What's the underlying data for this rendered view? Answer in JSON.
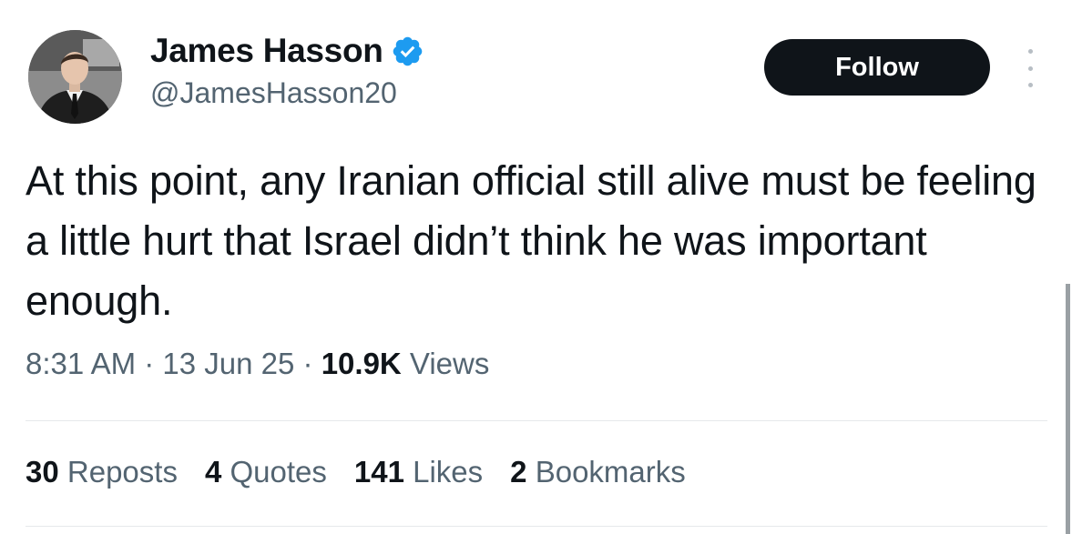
{
  "author": {
    "name": "James Hasson",
    "handle": "@JamesHasson20",
    "verified": true
  },
  "follow_label": "Follow",
  "tweet": {
    "text": "At this point, any Iranian official still alive must be feeling a little hurt that Israel didn’t think he was important enough."
  },
  "meta": {
    "time": "8:31 AM",
    "sep1": " · ",
    "date": "13 Jun 25",
    "sep2": " · ",
    "views_count": "10.9K",
    "views_label": " Views"
  },
  "stats": {
    "reposts_count": "30",
    "reposts_label": " Reposts",
    "quotes_count": "4",
    "quotes_label": " Quotes",
    "likes_count": "141",
    "likes_label": " Likes",
    "bookmarks_count": "2",
    "bookmarks_label": " Bookmarks"
  },
  "colors": {
    "text": "#0f1419",
    "secondary": "#536471",
    "verified_blue": "#1d9bf0",
    "follow_bg": "#0f1419"
  },
  "icons": {
    "verified": "verified-badge-icon",
    "more": "more-options-icon"
  }
}
